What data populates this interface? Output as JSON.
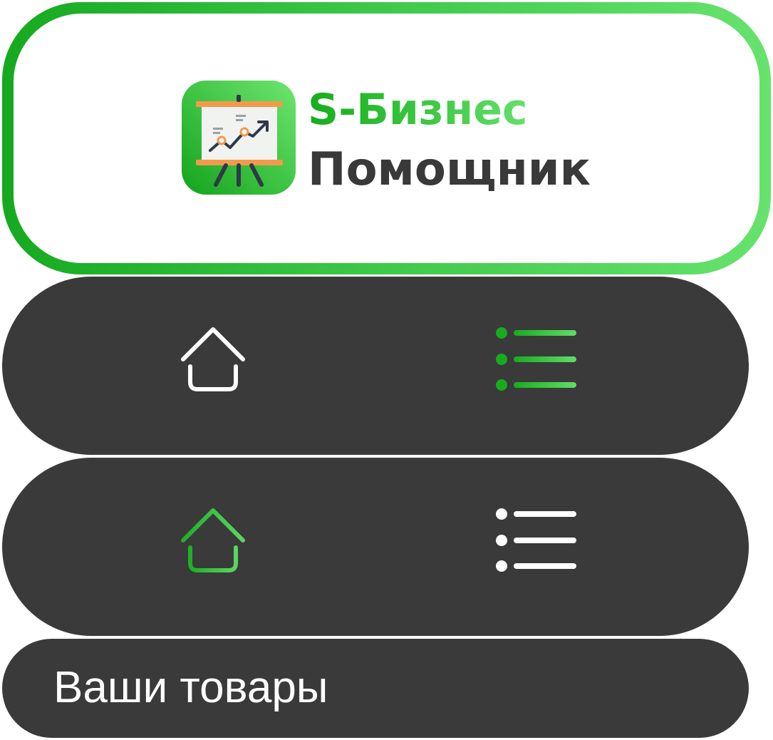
{
  "brand": {
    "name_line1": "S-Бизнес",
    "name_line2": "Помощник",
    "icon": "presentation-chart-icon",
    "accent_gradient": [
      "#17ac1e",
      "#66e06c"
    ],
    "text_color": "#393939"
  },
  "nav_bars": [
    {
      "active": "list",
      "items": [
        {
          "icon": "home-icon",
          "color": "#ffffff"
        },
        {
          "icon": "list-icon",
          "color": "#2fbf38"
        }
      ]
    },
    {
      "active": "home",
      "items": [
        {
          "icon": "home-icon",
          "color": "#2fbf38"
        },
        {
          "icon": "list-icon",
          "color": "#ffffff"
        }
      ]
    }
  ],
  "section": {
    "title": "Ваши товары"
  },
  "colors": {
    "bar_background": "#3a3a3a",
    "active": "#2fbf38",
    "inactive": "#ffffff"
  }
}
